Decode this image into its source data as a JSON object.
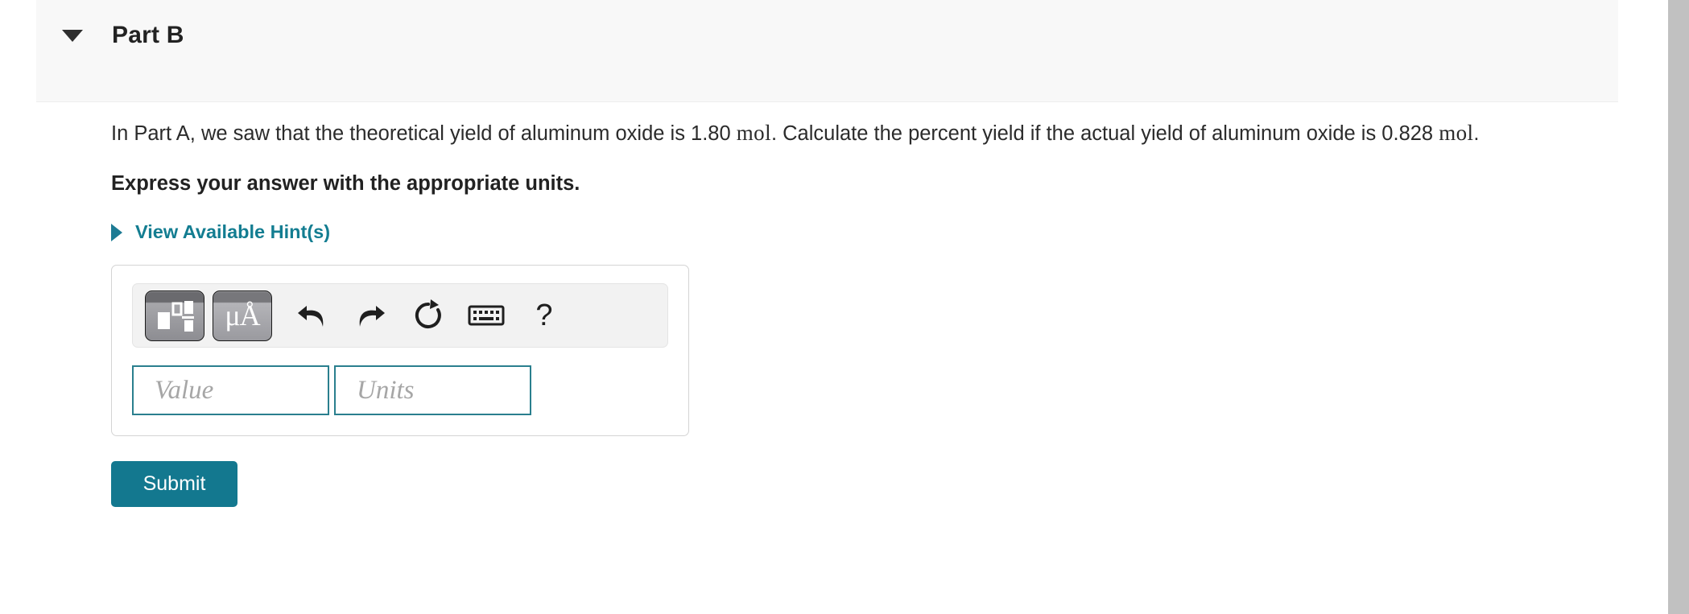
{
  "header": {
    "title": "Part B",
    "disclosure_icon": "triangle-down-icon"
  },
  "question": {
    "text_part1": "In Part A, we saw that the theoretical yield of aluminum oxide is ",
    "value1": "1.80",
    "unit1": "mol",
    "text_part2": ". Calculate the percent yield if the actual yield of aluminum oxide is ",
    "value2": "0.828",
    "unit2": "mol",
    "text_part3": ".",
    "instruction": "Express your answer with the appropriate units."
  },
  "hints": {
    "label": "View Available Hint(s)",
    "icon": "triangle-right-icon",
    "color": "#137d91"
  },
  "toolbar": {
    "buttons": [
      {
        "name": "template-icon",
        "label": ""
      },
      {
        "name": "units-icon",
        "label": "μÅ"
      },
      {
        "name": "undo-icon",
        "label": ""
      },
      {
        "name": "redo-icon",
        "label": ""
      },
      {
        "name": "reset-icon",
        "label": ""
      },
      {
        "name": "keyboard-icon",
        "label": ""
      },
      {
        "name": "help-icon",
        "label": "?"
      }
    ]
  },
  "answer": {
    "value_placeholder": "Value",
    "value_text": "",
    "units_placeholder": "Units",
    "units_text": ""
  },
  "submit": {
    "label": "Submit",
    "color": "#13788f"
  }
}
